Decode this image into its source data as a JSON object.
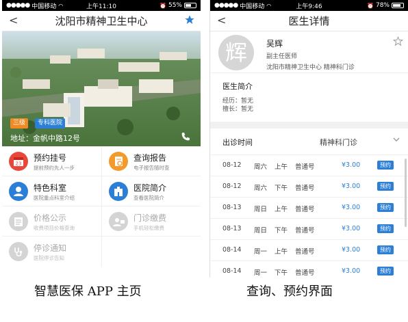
{
  "left_screen": {
    "status": {
      "carrier": "中国移动",
      "time": "上午11:10",
      "battery": "55%",
      "battery_level": 0.55
    },
    "nav": {
      "back": "<",
      "title": "沈阳市精神卫生中心"
    },
    "hero": {
      "tags": [
        "三级",
        "专科医院"
      ],
      "address": "地址：金帆中路12号"
    },
    "menu": [
      {
        "title": "预约挂号",
        "subtitle": "提前预约先人一步",
        "icon": "calendar-icon",
        "color": "#e8483b",
        "enabled": true
      },
      {
        "title": "查询报告",
        "subtitle": "电子报告随时查",
        "icon": "report-icon",
        "color": "#f39a2b",
        "enabled": true
      },
      {
        "title": "特色科室",
        "subtitle": "医院重点科室介绍",
        "icon": "department-icon",
        "color": "#2c7fd6",
        "enabled": true
      },
      {
        "title": "医院简介",
        "subtitle": "查看医院简介",
        "icon": "hospital-icon",
        "color": "#2c7fd6",
        "enabled": true
      },
      {
        "title": "价格公示",
        "subtitle": "收费项目价格查询",
        "icon": "price-icon",
        "color": "#bdbdbd",
        "enabled": false
      },
      {
        "title": "门诊缴费",
        "subtitle": "手机轻松缴费",
        "icon": "payment-icon",
        "color": "#bdbdbd",
        "enabled": false
      },
      {
        "title": "停诊通知",
        "subtitle": "医院停诊告知",
        "icon": "stethoscope-icon",
        "color": "#bdbdbd",
        "enabled": false
      }
    ]
  },
  "right_screen": {
    "status": {
      "carrier": "中国移动",
      "time": "上午9:46",
      "battery": "78%",
      "battery_level": 0.78
    },
    "nav": {
      "back": "<",
      "title": "医生详情"
    },
    "doctor": {
      "avatar_char": "辉",
      "name": "吴辉",
      "title": "副主任医师",
      "org": "沈阳市精神卫生中心  精神科门诊"
    },
    "intro": {
      "heading": "医生简介",
      "experience": "经历：暂无",
      "specialty": "擅长：暂无"
    },
    "schedule": {
      "label": "出诊时间",
      "department": "精神科门诊",
      "rows": [
        {
          "date": "08-12",
          "day": "周六",
          "half": "上午",
          "kind": "普通号",
          "price": "¥3.00",
          "action": "预约"
        },
        {
          "date": "08-12",
          "day": "周六",
          "half": "下午",
          "kind": "普通号",
          "price": "¥3.00",
          "action": "预约"
        },
        {
          "date": "08-13",
          "day": "周日",
          "half": "上午",
          "kind": "普通号",
          "price": "¥3.00",
          "action": "预约"
        },
        {
          "date": "08-13",
          "day": "周日",
          "half": "下午",
          "kind": "普通号",
          "price": "¥3.00",
          "action": "预约"
        },
        {
          "date": "08-14",
          "day": "周一",
          "half": "上午",
          "kind": "普通号",
          "price": "¥3.00",
          "action": "预约"
        },
        {
          "date": "08-14",
          "day": "周一",
          "half": "下午",
          "kind": "普通号",
          "price": "¥3.00",
          "action": "预约"
        }
      ]
    }
  },
  "captions": {
    "left": "智慧医保 APP 主页",
    "right": "查询、预约界面"
  },
  "colors": {
    "accent": "#2c7fd6",
    "price": "#2a7fd6",
    "tag_level": "#f08a24"
  }
}
